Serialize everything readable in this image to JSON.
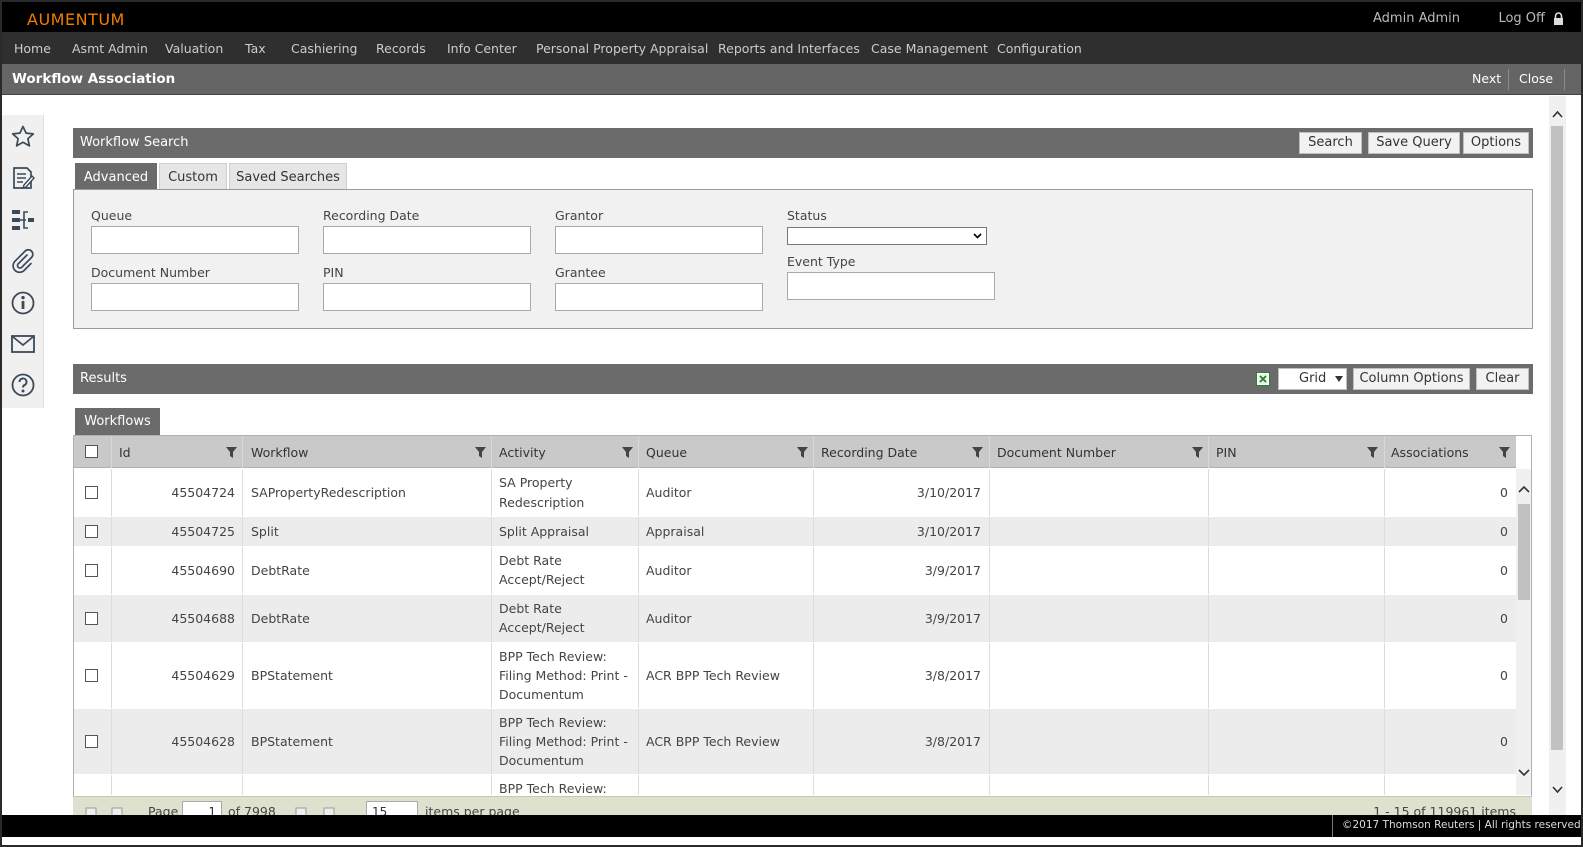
{
  "app": {
    "logo": "AUMENTUM",
    "user": "Admin Admin",
    "logoff": "Log Off"
  },
  "menu": [
    "Home",
    "Asmt Admin",
    "Valuation",
    "Tax",
    "Cashiering",
    "Records",
    "Info Center",
    "Personal Property Appraisal",
    "Reports and Interfaces",
    "Case Management",
    "Configuration"
  ],
  "page": {
    "title": "Workflow Association",
    "next": "Next",
    "close": "Close"
  },
  "rail_icons": [
    "star-icon",
    "notes-icon",
    "hierarchy-icon",
    "paperclip-icon",
    "info-icon",
    "mail-icon",
    "help-icon"
  ],
  "search": {
    "title": "Workflow Search",
    "buttons": {
      "search": "Search",
      "save_query": "Save Query",
      "options": "Options"
    },
    "tabs": [
      "Advanced",
      "Custom",
      "Saved Searches"
    ],
    "active_tab": "Advanced",
    "fields": {
      "queue": {
        "label": "Queue",
        "value": ""
      },
      "recording_date": {
        "label": "Recording Date",
        "value": ""
      },
      "grantor": {
        "label": "Grantor",
        "value": ""
      },
      "status": {
        "label": "Status",
        "value": ""
      },
      "document_number": {
        "label": "Document Number",
        "value": ""
      },
      "pin": {
        "label": "PIN",
        "value": ""
      },
      "grantee": {
        "label": "Grantee",
        "value": ""
      },
      "event_type": {
        "label": "Event Type",
        "value": ""
      }
    }
  },
  "results": {
    "title": "Results",
    "view": "Grid",
    "column_options": "Column Options",
    "clear": "Clear",
    "grid_tab": "Workflows",
    "columns": [
      "Id",
      "Workflow",
      "Activity",
      "Queue",
      "Recording Date",
      "Document Number",
      "PIN",
      "Associations"
    ],
    "rows": [
      {
        "id": "45504724",
        "workflow": "SAPropertyRedescription",
        "activity": [
          "SA Property",
          "Redescription"
        ],
        "queue": "Auditor",
        "recording_date": "3/10/2017",
        "document_number": "",
        "pin": "",
        "associations": "0"
      },
      {
        "id": "45504725",
        "workflow": "Split",
        "activity": [
          "Split Appraisal"
        ],
        "queue": "Appraisal",
        "recording_date": "3/10/2017",
        "document_number": "",
        "pin": "",
        "associations": "0"
      },
      {
        "id": "45504690",
        "workflow": "DebtRate",
        "activity": [
          "Debt Rate",
          "Accept/Reject"
        ],
        "queue": "Auditor",
        "recording_date": "3/9/2017",
        "document_number": "",
        "pin": "",
        "associations": "0"
      },
      {
        "id": "45504688",
        "workflow": "DebtRate",
        "activity": [
          "Debt Rate",
          "Accept/Reject"
        ],
        "queue": "Auditor",
        "recording_date": "3/9/2017",
        "document_number": "",
        "pin": "",
        "associations": "0"
      },
      {
        "id": "45504629",
        "workflow": "BPStatement",
        "activity": [
          "BPP Tech Review:",
          "Filing Method: Print -",
          "Documentum"
        ],
        "queue": "ACR BPP Tech Review",
        "recording_date": "3/8/2017",
        "document_number": "",
        "pin": "",
        "associations": "0"
      },
      {
        "id": "45504628",
        "workflow": "BPStatement",
        "activity": [
          "BPP Tech Review:",
          "Filing Method: Print -",
          "Documentum"
        ],
        "queue": "ACR BPP Tech Review",
        "recording_date": "3/8/2017",
        "document_number": "",
        "pin": "",
        "associations": "0"
      },
      {
        "id": "",
        "workflow": "",
        "activity": [
          "BPP Tech Review:"
        ],
        "queue": "",
        "recording_date": "",
        "document_number": "",
        "pin": "",
        "associations": ""
      }
    ],
    "pager": {
      "page_label": "Page",
      "page": "1",
      "of": "of 7998",
      "page_size": "15",
      "items_per_page": "items per page",
      "summary": "1 - 15 of 119961 items"
    }
  },
  "footer": "©2017 Thomson Reuters | All rights reserved",
  "colors": {
    "logo": "#f07d00",
    "menubar": "#2f2f2f",
    "panel_header": "#6b6b6b",
    "pager": "#dfe1cf"
  }
}
